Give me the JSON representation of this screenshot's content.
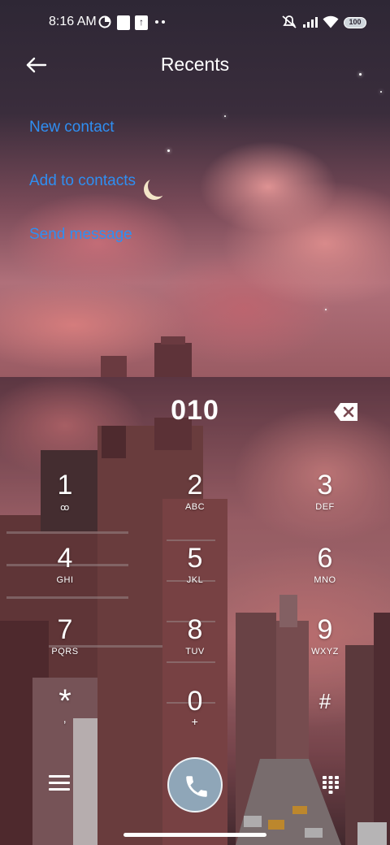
{
  "status_bar": {
    "time": "8:16 AM",
    "battery": "100",
    "left_icons": [
      "data-saver-icon",
      "notification-box-icon",
      "upload-icon",
      "more-dots-icon"
    ],
    "right_icons": [
      "mute-icon",
      "signal-icon",
      "wifi-icon",
      "battery-icon"
    ]
  },
  "header": {
    "title": "Recents",
    "back_icon": "back-arrow-icon"
  },
  "menu": {
    "new_contact": "New contact",
    "add_to_contacts": "Add to contacts",
    "send_message": "Send message",
    "link_color": "#2f8ff2"
  },
  "dialpad": {
    "number": "010",
    "keys": [
      {
        "digit": "1",
        "letters": "ꝏ"
      },
      {
        "digit": "2",
        "letters": "ABC"
      },
      {
        "digit": "3",
        "letters": "DEF"
      },
      {
        "digit": "4",
        "letters": "GHI"
      },
      {
        "digit": "5",
        "letters": "JKL"
      },
      {
        "digit": "6",
        "letters": "MNO"
      },
      {
        "digit": "7",
        "letters": "PQRS"
      },
      {
        "digit": "8",
        "letters": "TUV"
      },
      {
        "digit": "9",
        "letters": "WXYZ"
      },
      {
        "digit": "*",
        "letters": ","
      },
      {
        "digit": "0",
        "letters": "+"
      },
      {
        "digit": "#",
        "letters": ""
      }
    ],
    "call_button_color": "#8fa6b8"
  }
}
